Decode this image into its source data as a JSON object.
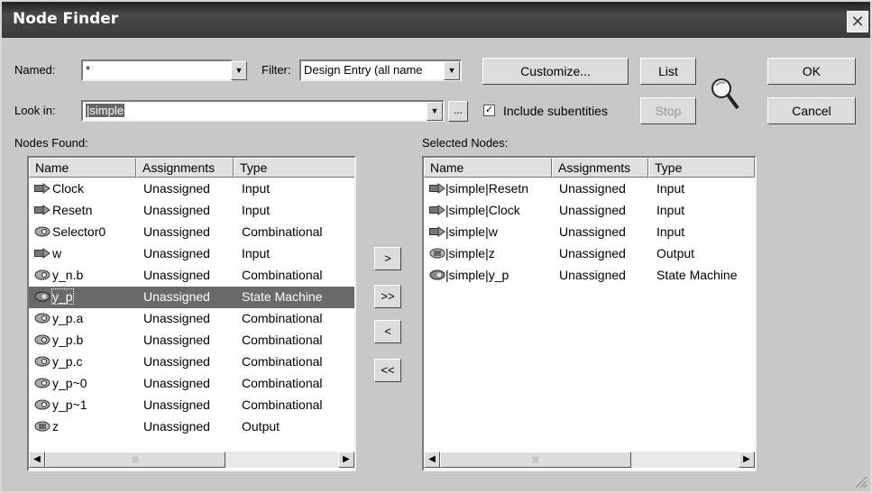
{
  "window": {
    "title": "Node Finder",
    "close_glyph": "✕"
  },
  "named": {
    "label": "Named:",
    "value": "*"
  },
  "filter": {
    "label": "Filter:",
    "value": "Design Entry (all name"
  },
  "buttons": {
    "customize": "Customize...",
    "list": "List",
    "stop": "Stop",
    "ok": "OK",
    "cancel": "Cancel",
    "browse": "...",
    "add": ">",
    "add_all": ">>",
    "remove": "<",
    "remove_all": "<<"
  },
  "look_in": {
    "label": "Look in:",
    "value": "|simple"
  },
  "include_subentities": {
    "label": "Include subentities",
    "checked": true,
    "mark": "✓"
  },
  "nodes_found": {
    "label": "Nodes Found:",
    "columns": [
      "Name",
      "Assignments",
      "Type"
    ],
    "rows": [
      {
        "name": "Clock",
        "assignment": "Unassigned",
        "type": "Input",
        "icon": "input-pin-icon"
      },
      {
        "name": "Resetn",
        "assignment": "Unassigned",
        "type": "Input",
        "icon": "input-pin-icon"
      },
      {
        "name": "Selector0",
        "assignment": "Unassigned",
        "type": "Combinational",
        "icon": "combinational-node-icon"
      },
      {
        "name": "w",
        "assignment": "Unassigned",
        "type": "Input",
        "icon": "input-pin-icon"
      },
      {
        "name": "y_n.b",
        "assignment": "Unassigned",
        "type": "Combinational",
        "icon": "combinational-node-icon"
      },
      {
        "name": "y_p",
        "assignment": "Unassigned",
        "type": "State Machine",
        "icon": "state-machine-icon",
        "selected": true
      },
      {
        "name": "y_p.a",
        "assignment": "Unassigned",
        "type": "Combinational",
        "icon": "combinational-node-icon"
      },
      {
        "name": "y_p.b",
        "assignment": "Unassigned",
        "type": "Combinational",
        "icon": "combinational-node-icon"
      },
      {
        "name": "y_p.c",
        "assignment": "Unassigned",
        "type": "Combinational",
        "icon": "combinational-node-icon"
      },
      {
        "name": "y_p~0",
        "assignment": "Unassigned",
        "type": "Combinational",
        "icon": "combinational-node-icon"
      },
      {
        "name": "y_p~1",
        "assignment": "Unassigned",
        "type": "Combinational",
        "icon": "combinational-node-icon"
      },
      {
        "name": "z",
        "assignment": "Unassigned",
        "type": "Output",
        "icon": "output-pin-icon"
      }
    ]
  },
  "selected_nodes": {
    "label": "Selected Nodes:",
    "columns": [
      "Name",
      "Assignments",
      "Type"
    ],
    "rows": [
      {
        "name": "|simple|Resetn",
        "assignment": "Unassigned",
        "type": "Input",
        "icon": "input-pin-icon"
      },
      {
        "name": "|simple|Clock",
        "assignment": "Unassigned",
        "type": "Input",
        "icon": "input-pin-icon"
      },
      {
        "name": "|simple|w",
        "assignment": "Unassigned",
        "type": "Input",
        "icon": "input-pin-icon"
      },
      {
        "name": "|simple|z",
        "assignment": "Unassigned",
        "type": "Output",
        "icon": "output-pin-icon"
      },
      {
        "name": "|simple|y_p",
        "assignment": "Unassigned",
        "type": "State Machine",
        "icon": "state-machine-icon"
      }
    ]
  },
  "scroll_glyphs": {
    "left": "◀",
    "right": "▶",
    "down": "▼",
    "grip": "|||"
  }
}
